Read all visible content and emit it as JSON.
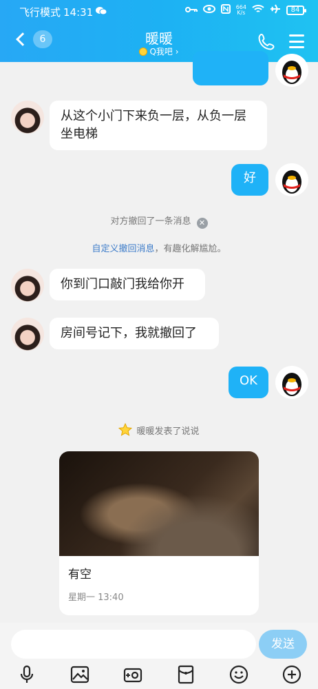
{
  "status_bar": {
    "airplane_mode": "飞行模式",
    "time": "14:31",
    "net_speed_value": "664",
    "net_speed_unit": "K/s",
    "battery": "84"
  },
  "header": {
    "unread_count": "6",
    "title": "暖暖",
    "subtitle": "Q我吧 ›"
  },
  "messages": [
    {
      "from": "contact",
      "text": "从这个小门下来负一层，从负一层坐电梯"
    },
    {
      "from": "me",
      "text": "好"
    },
    {
      "from": "system",
      "text": "对方撤回了一条消息"
    },
    {
      "from": "system",
      "link": "自定义撤回消息",
      "text": "，有趣化解尴尬。"
    },
    {
      "from": "contact",
      "text": "你到门口敲门我给你开"
    },
    {
      "from": "contact",
      "text": "房间号记下，我就撤回了"
    },
    {
      "from": "me",
      "text": "OK"
    },
    {
      "from": "system",
      "text": "暖暖发表了说说"
    }
  ],
  "post_card": {
    "caption": "有空",
    "time": "星期一 13:40"
  },
  "composer": {
    "send_label": "发送"
  },
  "icons": {
    "back": "chevron-left-icon",
    "call": "phone-icon",
    "menu": "menu-icon",
    "voice": "microphone-icon",
    "image": "image-icon",
    "camera": "camera-icon",
    "redpacket": "red-packet-icon",
    "emoji": "emoji-icon",
    "more": "plus-circle-icon"
  },
  "colors": {
    "header_blue": "#1fb2f7",
    "bubble_out": "#1fb2f7",
    "send_button": "#8ccef5",
    "link": "#3d7cc9"
  }
}
